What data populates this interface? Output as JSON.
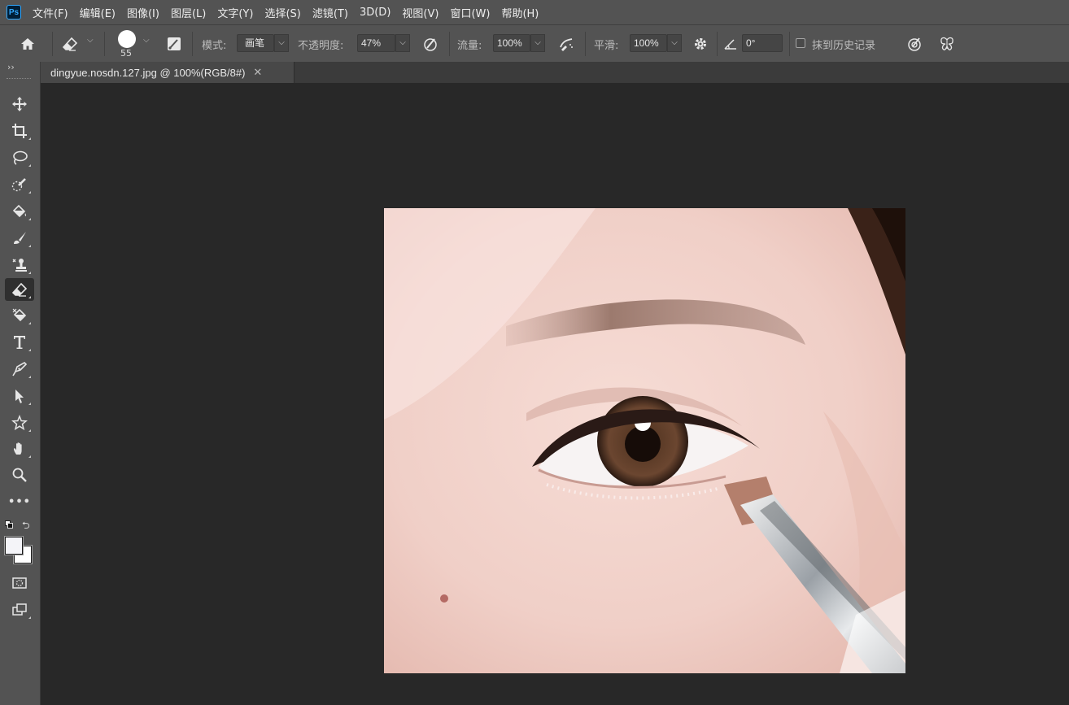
{
  "app": {
    "logo": "Ps"
  },
  "menu": [
    "文件(F)",
    "编辑(E)",
    "图像(I)",
    "图层(L)",
    "文字(Y)",
    "选择(S)",
    "滤镜(T)",
    "3D(D)",
    "视图(V)",
    "窗口(W)",
    "帮助(H)"
  ],
  "options": {
    "brush_size": "55",
    "mode_label": "模式:",
    "mode_value": "画笔",
    "opacity_label": "不透明度:",
    "opacity_value": "47%",
    "flow_label": "流量:",
    "flow_value": "100%",
    "smoothing_label": "平滑:",
    "smoothing_value": "100%",
    "angle_value": "0°",
    "erase_history_label": "抹到历史记录"
  },
  "document": {
    "tab_title": "dingyue.nosdn.127.jpg @ 100%(RGB/8#)",
    "close_glyph": "✕"
  },
  "toolbar": {
    "collapse_glyph": "››",
    "more_glyph": "•••"
  },
  "tools": [
    {
      "name": "move-tool",
      "icon": "move-icon"
    },
    {
      "name": "crop-tool",
      "icon": "crop-icon"
    },
    {
      "name": "lasso-tool",
      "icon": "lasso-icon"
    },
    {
      "name": "quick-selection-tool",
      "icon": "quick-selection-icon"
    },
    {
      "name": "paint-bucket-tool",
      "icon": "paint-bucket-icon"
    },
    {
      "name": "brush-tool",
      "icon": "brush-icon"
    },
    {
      "name": "clone-stamp-tool",
      "icon": "clone-stamp-icon"
    },
    {
      "name": "eraser-tool",
      "icon": "eraser-icon",
      "active": true
    },
    {
      "name": "background-eraser-tool",
      "icon": "background-eraser-icon"
    },
    {
      "name": "type-tool",
      "icon": "type-icon"
    },
    {
      "name": "pen-tool",
      "icon": "pen-icon"
    },
    {
      "name": "path-selection-tool",
      "icon": "path-selection-icon"
    },
    {
      "name": "custom-shape-tool",
      "icon": "custom-shape-icon"
    },
    {
      "name": "hand-tool",
      "icon": "hand-icon"
    },
    {
      "name": "zoom-tool",
      "icon": "zoom-icon"
    }
  ],
  "colors": {
    "foreground": "#f4f4f8",
    "background": "#ffffff",
    "accent": "#31a8ff"
  }
}
